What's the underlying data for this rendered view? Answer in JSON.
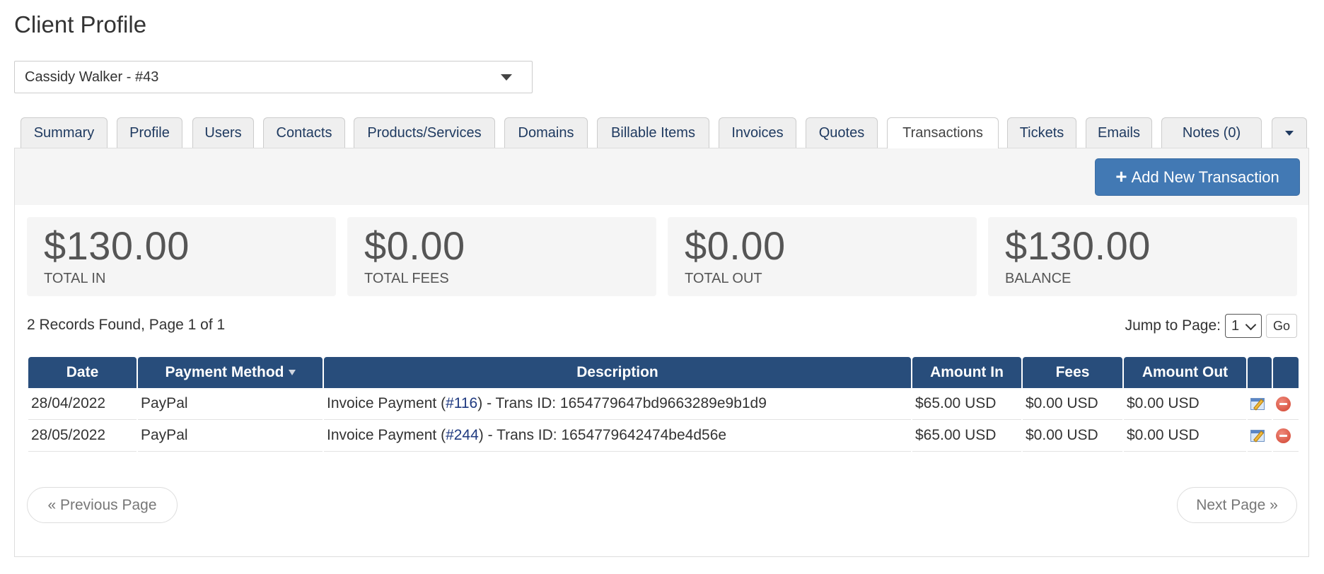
{
  "page": {
    "title": "Client Profile"
  },
  "client_select": {
    "value": "Cassidy Walker - #43"
  },
  "tabs": [
    {
      "label": "Summary"
    },
    {
      "label": "Profile"
    },
    {
      "label": "Users"
    },
    {
      "label": "Contacts"
    },
    {
      "label": "Products/Services"
    },
    {
      "label": "Domains"
    },
    {
      "label": "Billable Items"
    },
    {
      "label": "Invoices"
    },
    {
      "label": "Quotes"
    },
    {
      "label": "Transactions",
      "active": true
    },
    {
      "label": "Tickets"
    },
    {
      "label": "Emails"
    },
    {
      "label": "Notes (0)"
    }
  ],
  "toolbar": {
    "add_label": "Add New Transaction",
    "add_icon": "plus-icon"
  },
  "stats": [
    {
      "value": "$130.00",
      "label": "TOTAL IN"
    },
    {
      "value": "$0.00",
      "label": "TOTAL FEES"
    },
    {
      "value": "$0.00",
      "label": "TOTAL OUT"
    },
    {
      "value": "$130.00",
      "label": "BALANCE"
    }
  ],
  "records": {
    "summary": "2 Records Found, Page 1 of 1"
  },
  "jump": {
    "label": "Jump to Page:",
    "value": "1",
    "go_label": "Go"
  },
  "table": {
    "columns": [
      "Date",
      "Payment Method",
      "Description",
      "Amount In",
      "Fees",
      "Amount Out",
      "",
      ""
    ],
    "sorted_column": "Payment Method",
    "rows": [
      {
        "date": "28/04/2022",
        "method": "PayPal",
        "desc_pre": "Invoice Payment (",
        "invoice": "#116",
        "desc_post": ") - Trans ID: 1654779647bd9663289e9b1d9",
        "amount_in": "$65.00 USD",
        "fees": "$0.00 USD",
        "amount_out": "$0.00 USD"
      },
      {
        "date": "28/05/2022",
        "method": "PayPal",
        "desc_pre": "Invoice Payment (",
        "invoice": "#244",
        "desc_post": ") - Trans ID: 1654779642474be4d56e",
        "amount_in": "$65.00 USD",
        "fees": "$0.00 USD",
        "amount_out": "$0.00 USD"
      }
    ]
  },
  "pagination": {
    "prev_label": "« Previous Page",
    "next_label": "Next Page »"
  },
  "colors": {
    "header": "#284d7b",
    "accent_button": "#4279b4",
    "link": "#1f3a80"
  }
}
